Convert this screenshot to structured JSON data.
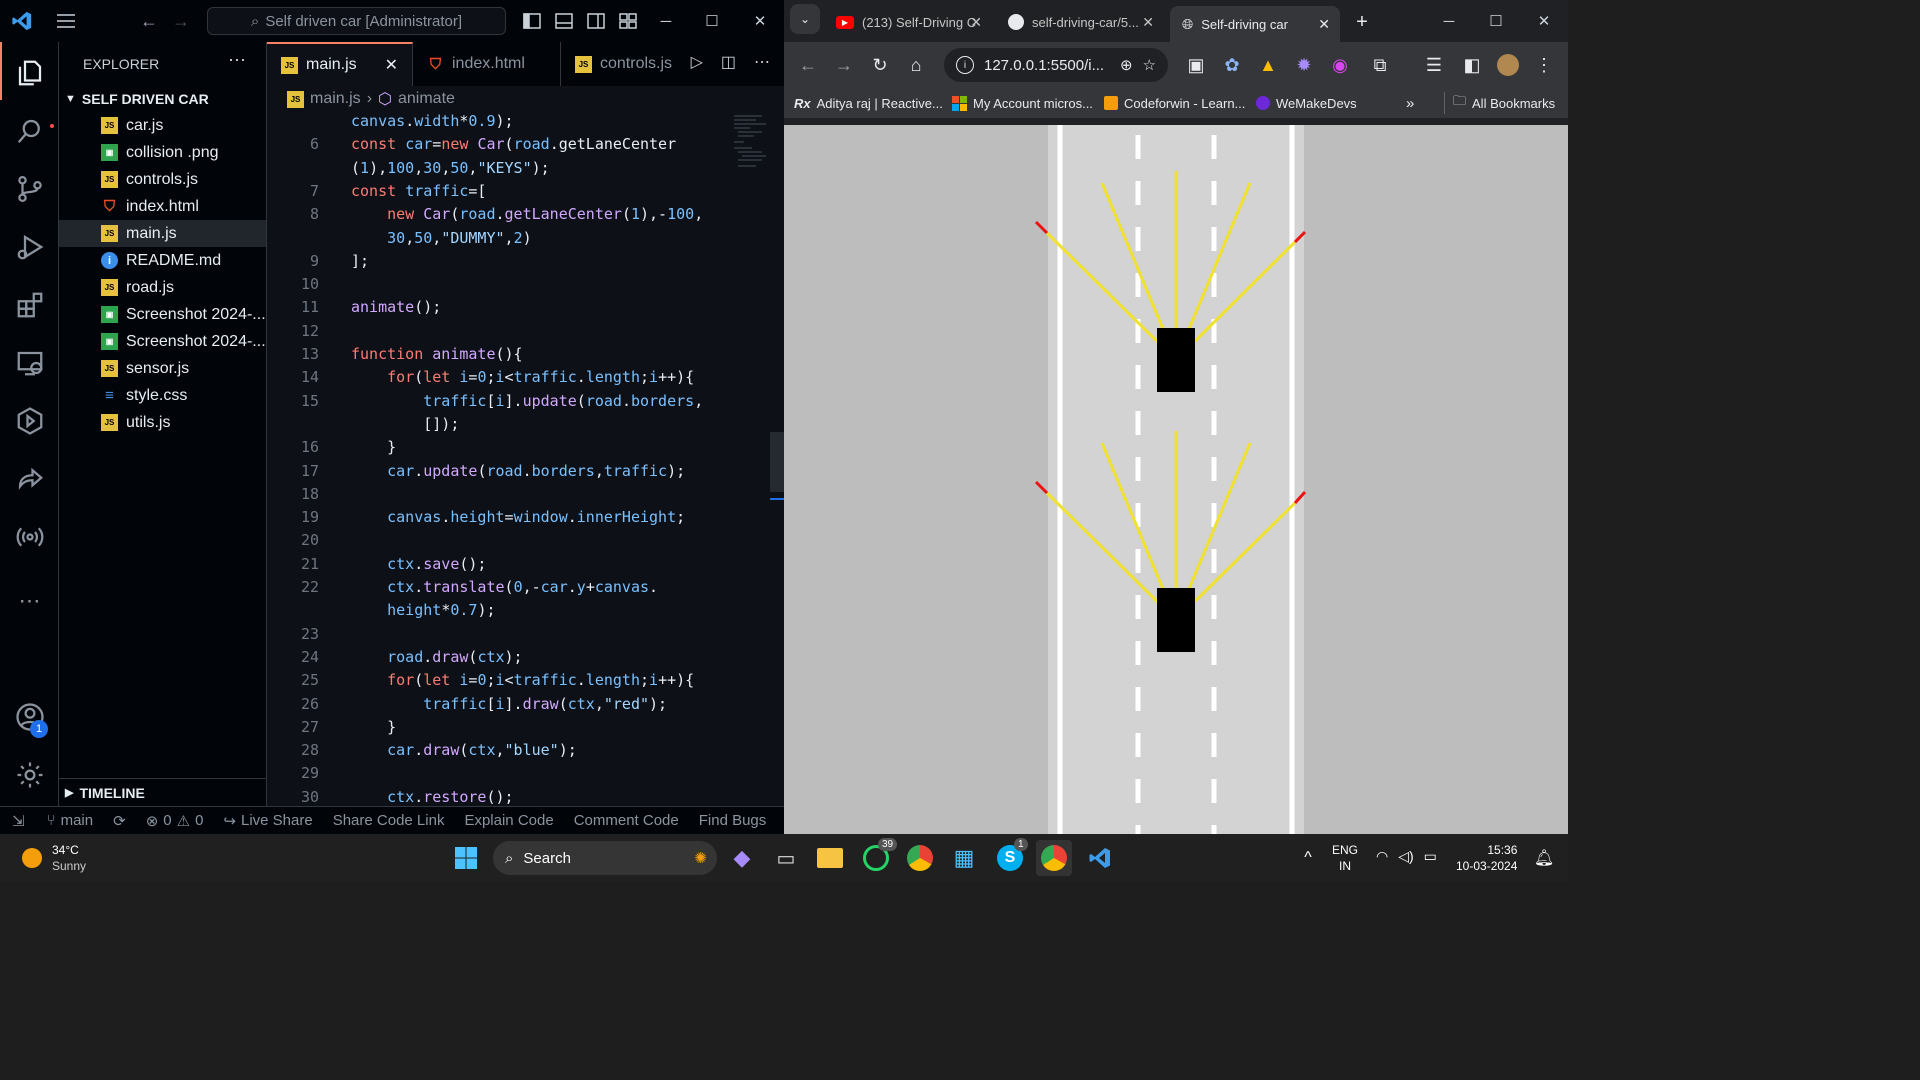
{
  "vscode": {
    "title": "Self driven car [Administrator]",
    "explorer_title": "EXPLORER",
    "folder": "SELF DRIVEN CAR",
    "files": [
      {
        "name": "car.js",
        "type": "js"
      },
      {
        "name": "collision .png",
        "type": "img"
      },
      {
        "name": "controls.js",
        "type": "js"
      },
      {
        "name": "index.html",
        "type": "html"
      },
      {
        "name": "main.js",
        "type": "js",
        "selected": true
      },
      {
        "name": "README.md",
        "type": "md"
      },
      {
        "name": "road.js",
        "type": "js"
      },
      {
        "name": "Screenshot 2024-...",
        "type": "img"
      },
      {
        "name": "Screenshot 2024-...",
        "type": "img"
      },
      {
        "name": "sensor.js",
        "type": "js"
      },
      {
        "name": "style.css",
        "type": "css"
      },
      {
        "name": "utils.js",
        "type": "js"
      }
    ],
    "timeline": "TIMELINE",
    "tabs": [
      {
        "label": "main.js",
        "active": true
      },
      {
        "label": "index.html"
      },
      {
        "label": "controls.js"
      }
    ],
    "breadcrumb": {
      "file": "main.js",
      "symbol": "animate"
    },
    "code_lines": [
      {
        "num": "",
        "text": "canvas.width*0.9);"
      },
      {
        "num": "6",
        "text": "const car=new Car(road.getLaneCenter"
      },
      {
        "num": "",
        "text": "(1),100,30,50,\"KEYS\");"
      },
      {
        "num": "7",
        "text": "const traffic=["
      },
      {
        "num": "8",
        "text": "    new Car(road.getLaneCenter(1),-100,"
      },
      {
        "num": "",
        "text": "    30,50,\"DUMMY\",2)"
      },
      {
        "num": "9",
        "text": "];"
      },
      {
        "num": "10",
        "text": ""
      },
      {
        "num": "11",
        "text": "animate();"
      },
      {
        "num": "12",
        "text": ""
      },
      {
        "num": "13",
        "text": "function animate(){"
      },
      {
        "num": "14",
        "text": "    for(let i=0;i<traffic.length;i++){"
      },
      {
        "num": "15",
        "text": "        traffic[i].update(road.borders,"
      },
      {
        "num": "",
        "text": "        []);"
      },
      {
        "num": "16",
        "text": "    }"
      },
      {
        "num": "17",
        "text": "    car.update(road.borders,traffic);"
      },
      {
        "num": "18",
        "text": ""
      },
      {
        "num": "19",
        "text": "    canvas.height=window.innerHeight;"
      },
      {
        "num": "20",
        "text": ""
      },
      {
        "num": "21",
        "text": "    ctx.save();"
      },
      {
        "num": "22",
        "text": "    ctx.translate(0,-car.y+canvas."
      },
      {
        "num": "",
        "text": "    height*0.7);"
      },
      {
        "num": "23",
        "text": ""
      },
      {
        "num": "24",
        "text": "    road.draw(ctx);"
      },
      {
        "num": "25",
        "text": "    for(let i=0;i<traffic.length;i++){"
      },
      {
        "num": "26",
        "text": "        traffic[i].draw(ctx,\"red\");"
      },
      {
        "num": "27",
        "text": "    }"
      },
      {
        "num": "28",
        "text": "    car.draw(ctx,\"blue\");"
      },
      {
        "num": "29",
        "text": ""
      },
      {
        "num": "30",
        "text": "    ctx.restore();"
      }
    ],
    "status": {
      "branch": "main",
      "errors": "0",
      "warnings": "0",
      "live_share": "Live Share",
      "share_link": "Share Code Link",
      "explain": "Explain Code",
      "comment": "Comment Code",
      "bugs": "Find Bugs"
    },
    "badge": "1"
  },
  "browser": {
    "tabs": [
      {
        "label": "(213) Self-Driving C",
        "icon": "youtube-icon"
      },
      {
        "label": "self-driving-car/5...",
        "icon": "github-icon"
      },
      {
        "label": "Self-driving car",
        "icon": "globe-icon",
        "active": true
      }
    ],
    "url": "127.0.0.1:5500/i...",
    "bookmarks": [
      {
        "label": "Aditya raj | Reactive...",
        "icon": "rx-icon"
      },
      {
        "label": "My Account micros...",
        "icon": "microsoft-icon"
      },
      {
        "label": "Codeforwin - Learn...",
        "icon": "codeforwin-icon"
      },
      {
        "label": "WeMakeDevs",
        "icon": "wemakedevs-icon"
      }
    ],
    "all_bookmarks": "All Bookmarks"
  },
  "taskbar": {
    "weather_temp": "34°C",
    "weather_desc": "Sunny",
    "search": "Search",
    "whatsapp_badge": "39",
    "skype_badge": "1",
    "lang": "ENG",
    "region": "IN",
    "time": "15:36",
    "date": "10-03-2024"
  }
}
